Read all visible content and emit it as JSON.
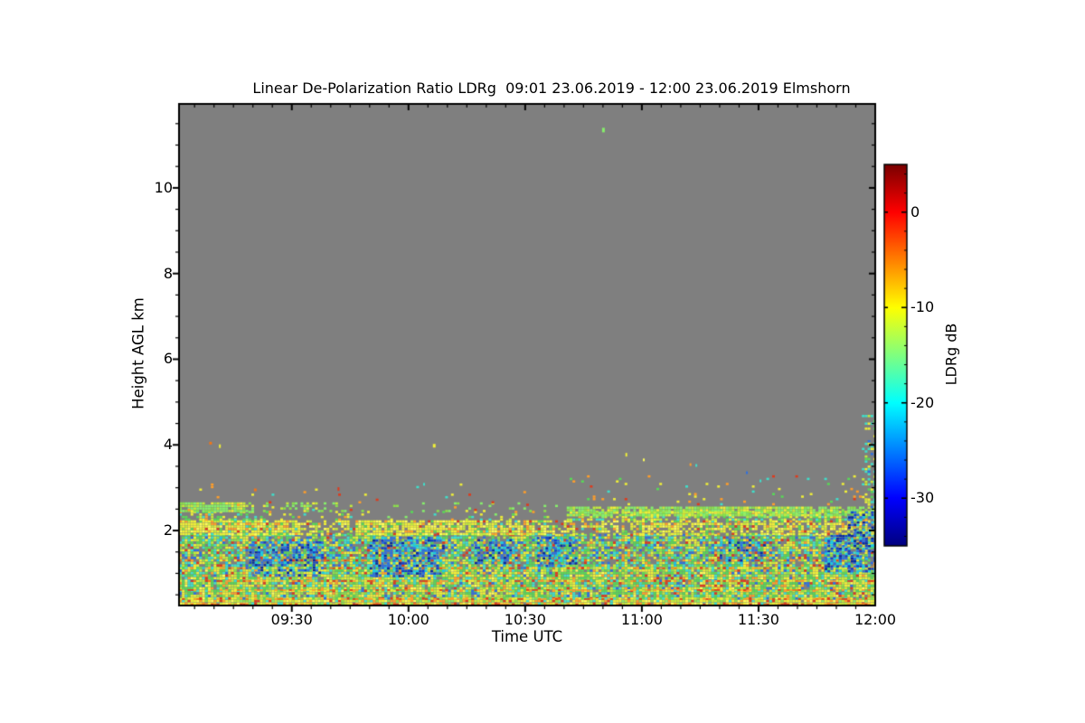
{
  "chart_data": {
    "type": "heatmap",
    "title": "Linear De-Polarization Ratio LDRg  09:01 23.06.2019 - 12:00 23.06.2019 Elmshorn",
    "xlabel": "Time UTC",
    "ylabel": "Height AGL km",
    "x_axis": {
      "unit": "minutes after 09:00 UTC",
      "range": [
        1,
        180
      ],
      "ticks": [
        {
          "label": "09:30",
          "t": 30
        },
        {
          "label": "10:00",
          "t": 60
        },
        {
          "label": "10:30",
          "t": 90
        },
        {
          "label": "11:00",
          "t": 120
        },
        {
          "label": "11:30",
          "t": 150
        },
        {
          "label": "12:00",
          "t": 180
        }
      ],
      "minor_step": 5
    },
    "y_axis": {
      "unit": "km",
      "range": [
        0.25,
        11.96
      ],
      "ticks": [
        {
          "label": "2",
          "h": 2
        },
        {
          "label": "4",
          "h": 4
        },
        {
          "label": "6",
          "h": 6
        },
        {
          "label": "8",
          "h": 8
        },
        {
          "label": "10",
          "h": 10
        }
      ],
      "minor_step": 0.5
    },
    "colorbar": {
      "label": "LDRg dB",
      "range_db": [
        5,
        -35
      ],
      "ticks": [
        {
          "label": "0",
          "v": 0
        },
        {
          "label": "-10",
          "v": -10
        },
        {
          "label": "-20",
          "v": -20
        },
        {
          "label": "-30",
          "v": -30
        }
      ],
      "minor_step_db": 2,
      "colormap": "jet",
      "stops": [
        [
          0,
          "#7A0000"
        ],
        [
          0.125,
          "#FF0000"
        ],
        [
          0.375,
          "#FFFF00"
        ],
        [
          0.625,
          "#00FFFF"
        ],
        [
          0.875,
          "#0000FF"
        ],
        [
          1,
          "#00007F"
        ]
      ]
    },
    "no_data_color": "#7F7F7F",
    "frame_color": "#000000",
    "seed": 1337,
    "palette": {
      "green": "#58D957",
      "green2": "#8BE04B",
      "lgreen": "#86EF6B",
      "ygreen": "#C3EA3C",
      "yellow": "#EFEF38",
      "yellow2": "#FFFF5A",
      "cyan": "#3FDFCB",
      "cyan2": "#18C8E8",
      "blue": "#2E6FE0",
      "blue2": "#1641C8",
      "dblue": "#0A28A0",
      "orange": "#FF9E2A",
      "orange2": "#F07418",
      "red": "#DE3A1C",
      "dred": "#AF1A0C"
    },
    "bands": [
      {
        "name": "surface-rows",
        "h": [
          0.25,
          0.44
        ],
        "segments": [
          [
            1,
            180,
            0.97
          ]
        ],
        "colors": [
          [
            "yellow",
            0.26
          ],
          [
            "yellow2",
            0.12
          ],
          [
            "ygreen",
            0.16
          ],
          [
            "green2",
            0.14
          ],
          [
            "orange",
            0.12
          ],
          [
            "red",
            0.08
          ],
          [
            "lgreen",
            0.06
          ],
          [
            "cyan",
            0.06
          ]
        ]
      },
      {
        "name": "low-layer",
        "h": [
          0.44,
          1.15
        ],
        "segments": [
          [
            1,
            180,
            0.93
          ]
        ],
        "colors": [
          [
            "green",
            0.2
          ],
          [
            "ygreen",
            0.16
          ],
          [
            "yellow",
            0.22
          ],
          [
            "cyan",
            0.14
          ],
          [
            "green2",
            0.1
          ],
          [
            "orange",
            0.07
          ],
          [
            "red",
            0.04
          ],
          [
            "blue",
            0.04
          ],
          [
            "yellow2",
            0.03
          ]
        ]
      },
      {
        "name": "mid-layer",
        "h": [
          1.15,
          1.92
        ],
        "segments": [
          [
            1,
            180,
            0.8
          ]
        ],
        "colors": [
          [
            "green",
            0.22
          ],
          [
            "cyan",
            0.2
          ],
          [
            "yellow",
            0.17
          ],
          [
            "ygreen",
            0.12
          ],
          [
            "blue",
            0.09
          ],
          [
            "green2",
            0.08
          ],
          [
            "orange",
            0.05
          ],
          [
            "red",
            0.04
          ],
          [
            "cyan2",
            0.03
          ]
        ]
      },
      {
        "name": "yellow-band",
        "h": [
          1.92,
          2.24
        ],
        "segments": [
          [
            1,
            32,
            0.92
          ],
          [
            32,
            46,
            0.5
          ],
          [
            46,
            95,
            0.85
          ],
          [
            95,
            118,
            0.55
          ],
          [
            118,
            180,
            0.72
          ]
        ],
        "colors": [
          [
            "yellow",
            0.4
          ],
          [
            "yellow2",
            0.17
          ],
          [
            "ygreen",
            0.14
          ],
          [
            "orange",
            0.1
          ],
          [
            "green",
            0.1
          ],
          [
            "red",
            0.03
          ],
          [
            "cyan",
            0.03
          ],
          [
            "green2",
            0.03
          ]
        ]
      },
      {
        "name": "gap-band",
        "h": [
          2.24,
          2.46
        ],
        "segments": [
          [
            1,
            20,
            0.5
          ],
          [
            20,
            100,
            0.12
          ],
          [
            100,
            180,
            0.55
          ]
        ],
        "colors": [
          [
            "yellow",
            0.3
          ],
          [
            "green",
            0.24
          ],
          [
            "ygreen",
            0.15
          ],
          [
            "cyan",
            0.15
          ],
          [
            "orange",
            0.08
          ],
          [
            "lgreen",
            0.08
          ]
        ]
      },
      {
        "name": "bright-line-left",
        "h": [
          2.48,
          2.66
        ],
        "segments": [
          [
            1,
            18,
            0.95
          ],
          [
            18,
            45,
            0.28
          ],
          [
            45,
            100,
            0.1
          ]
        ],
        "colors": [
          [
            "lgreen",
            0.45
          ],
          [
            "green2",
            0.25
          ],
          [
            "ygreen",
            0.15
          ],
          [
            "yellow",
            0.15
          ]
        ]
      },
      {
        "name": "bright-line-right",
        "h": [
          2.36,
          2.56
        ],
        "segments": [
          [
            100,
            170,
            0.85
          ],
          [
            170,
            180,
            0.4
          ]
        ],
        "colors": [
          [
            "lgreen",
            0.4
          ],
          [
            "green2",
            0.25
          ],
          [
            "ygreen",
            0.2
          ],
          [
            "yellow",
            0.15
          ]
        ]
      },
      {
        "name": "scatter-3km-right",
        "h": [
          2.6,
          3.35
        ],
        "segments": [
          [
            100,
            180,
            0.05
          ]
        ],
        "colors": [
          [
            "orange",
            0.25
          ],
          [
            "yellow",
            0.25
          ],
          [
            "green",
            0.2
          ],
          [
            "cyan",
            0.15
          ],
          [
            "red",
            0.15
          ]
        ]
      },
      {
        "name": "scatter-left",
        "h": [
          2.5,
          3.1
        ],
        "segments": [
          [
            1,
            100,
            0.02
          ]
        ],
        "colors": [
          [
            "orange",
            0.3
          ],
          [
            "yellow",
            0.3
          ],
          [
            "red",
            0.2
          ],
          [
            "cyan",
            0.2
          ]
        ]
      },
      {
        "name": "right-edge-plume",
        "h": [
          2.56,
          4.7
        ],
        "segments": [
          [
            176.5,
            180,
            0.3
          ]
        ],
        "colors": [
          [
            "cyan",
            0.3
          ],
          [
            "green",
            0.25
          ],
          [
            "yellow",
            0.2
          ],
          [
            "ygreen",
            0.15
          ],
          [
            "blue",
            0.1
          ]
        ]
      }
    ],
    "streaks": {
      "rows": [
        {
          "h": 0.3,
          "density": 0.5
        },
        {
          "h": 0.42,
          "density": 0.45
        },
        {
          "h": 0.63,
          "density": 0.45
        },
        {
          "h": 0.84,
          "density": 0.4
        },
        {
          "h": 1.14,
          "density": 0.35
        },
        {
          "h": 1.32,
          "density": 0.3
        }
      ],
      "colors": [
        [
          "orange",
          0.35
        ],
        [
          "red",
          0.3
        ],
        [
          "orange2",
          0.2
        ],
        [
          "yellow",
          0.15
        ]
      ]
    },
    "patches": {
      "areas": [
        {
          "t": [
            19,
            38
          ],
          "h": [
            0.95,
            1.75
          ],
          "density": 0.5
        },
        {
          "t": [
            50,
            69
          ],
          "h": [
            0.95,
            1.85
          ],
          "density": 0.55
        },
        {
          "t": [
            77,
            88
          ],
          "h": [
            1.25,
            1.8
          ],
          "density": 0.4
        },
        {
          "t": [
            93,
            103
          ],
          "h": [
            1.15,
            1.85
          ],
          "density": 0.5
        },
        {
          "t": [
            140,
            152
          ],
          "h": [
            1.3,
            1.8
          ],
          "density": 0.32
        },
        {
          "t": [
            167,
            180
          ],
          "h": [
            1.05,
            1.9
          ],
          "density": 0.5
        },
        {
          "t": [
            173,
            180
          ],
          "h": [
            1.9,
            2.45
          ],
          "density": 0.45
        }
      ],
      "colors": [
        [
          "blue",
          0.38
        ],
        [
          "blue2",
          0.24
        ],
        [
          "cyan2",
          0.22
        ],
        [
          "dblue",
          0.16
        ]
      ]
    },
    "dots": [
      {
        "t": 110,
        "h": 11.35,
        "color": "lgreen",
        "w": 3,
        "ht": 5
      },
      {
        "t": 9,
        "h": 4.04,
        "color": "orange2",
        "w": 3,
        "ht": 3
      },
      {
        "t": 11.5,
        "h": 3.97,
        "color": "yellow",
        "w": 2,
        "ht": 4
      },
      {
        "t": 66.5,
        "h": 3.98,
        "color": "yellow",
        "w": 3,
        "ht": 4
      },
      {
        "t": 42,
        "h": 2.97,
        "color": "red",
        "w": 2,
        "ht": 4
      },
      {
        "t": 20.5,
        "h": 2.95,
        "color": "orange2",
        "w": 3,
        "ht": 3
      },
      {
        "t": 64,
        "h": 3.08,
        "color": "cyan",
        "w": 2,
        "ht": 3
      },
      {
        "t": 116,
        "h": 3.77,
        "color": "yellow",
        "w": 2,
        "ht": 4
      },
      {
        "t": 120.5,
        "h": 3.65,
        "color": "yellow2",
        "w": 2,
        "ht": 3
      },
      {
        "t": 132.5,
        "h": 3.54,
        "color": "orange",
        "w": 2,
        "ht": 3
      },
      {
        "t": 134,
        "h": 3.52,
        "color": "cyan",
        "w": 2,
        "ht": 3
      },
      {
        "t": 147,
        "h": 3.35,
        "color": "blue",
        "w": 2,
        "ht": 3
      },
      {
        "t": 150.5,
        "h": 3.16,
        "color": "cyan",
        "w": 2,
        "ht": 3
      }
    ]
  }
}
